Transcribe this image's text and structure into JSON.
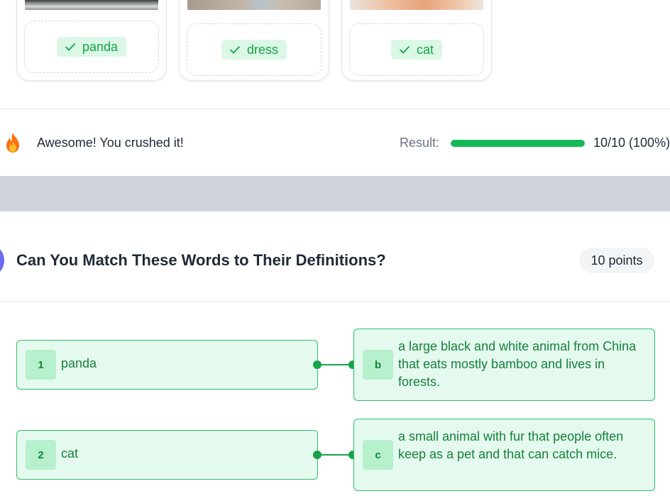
{
  "image_cards": [
    {
      "word": "panda",
      "image": "panda photo"
    },
    {
      "word": "dress",
      "image": "dress photo"
    },
    {
      "word": "cat",
      "image": "cat photo"
    }
  ],
  "result": {
    "message": "Awesome! You crushed it!",
    "label": "Result:",
    "score": "10/10 (100%)",
    "progress": 1.0,
    "icon": "flame-icon",
    "bar_color": "#15b857"
  },
  "question": {
    "title": "Can You Match These Words to Their Definitions?",
    "points": "10 points"
  },
  "pairs": [
    {
      "term_index": "1",
      "term": "panda",
      "def_letter": "b",
      "definition": "a large black and white animal from China that eats mostly bamboo and lives in forests."
    },
    {
      "term_index": "2",
      "term": "cat",
      "def_letter": "c",
      "definition": "a small animal with fur that people often keep as a pet and that can catch mice."
    }
  ],
  "colors": {
    "correct_bg": "#e5faee",
    "correct_border": "#2fbf6b",
    "correct_text": "#15803d",
    "accent": "#6d6af2"
  }
}
